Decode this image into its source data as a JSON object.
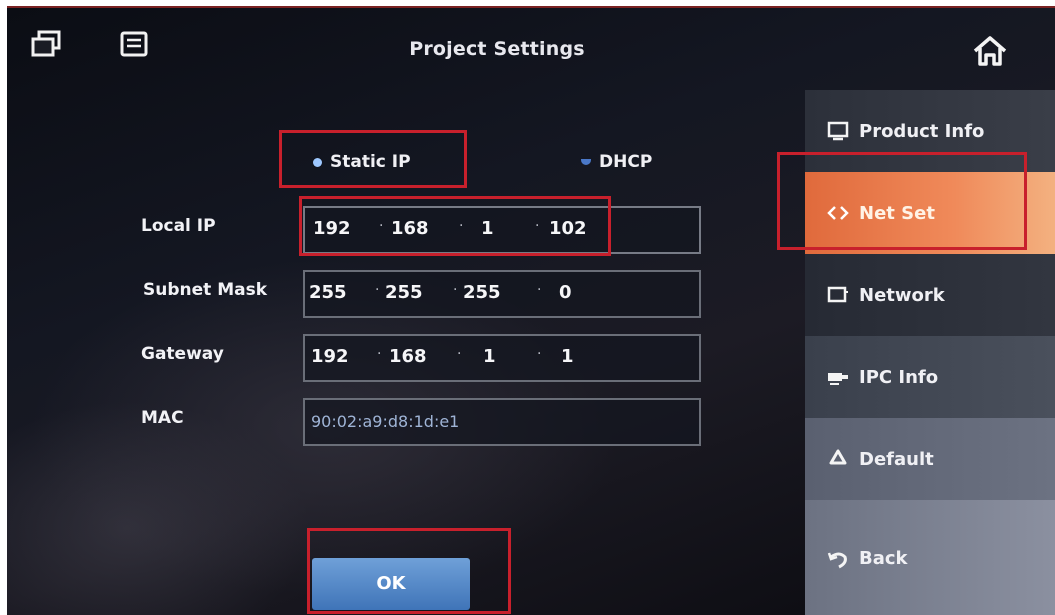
{
  "header": {
    "title": "Project Settings"
  },
  "network": {
    "mode_options": [
      {
        "label": "Static IP",
        "selected": true
      },
      {
        "label": "DHCP",
        "selected": false
      }
    ],
    "labels": {
      "local_ip": "Local IP",
      "subnet_mask": "Subnet Mask",
      "gateway": "Gateway",
      "mac": "MAC"
    },
    "local_ip": [
      "192",
      "168",
      "1",
      "102"
    ],
    "subnet_mask": [
      "255",
      "255",
      "255",
      "0"
    ],
    "gateway": [
      "192",
      "168",
      "1",
      "1"
    ],
    "mac": "90:02:a9:d8:1d:e1",
    "ok_label": "OK"
  },
  "sidebar": {
    "items": [
      {
        "label": "Product Info",
        "icon": "monitor-icon",
        "active": false
      },
      {
        "label": "Net Set",
        "icon": "code-brackets-icon",
        "active": true
      },
      {
        "label": "Network",
        "icon": "network-icon",
        "active": false
      },
      {
        "label": "IPC Info",
        "icon": "camera-icon",
        "active": false
      },
      {
        "label": "Default",
        "icon": "recycle-icon",
        "active": false
      },
      {
        "label": "Back",
        "icon": "back-arrow-icon",
        "active": false
      }
    ]
  },
  "colors": {
    "active_tab": "#f08a5a",
    "ok_button": "#4f84c6",
    "annotation": "#c8202c"
  }
}
